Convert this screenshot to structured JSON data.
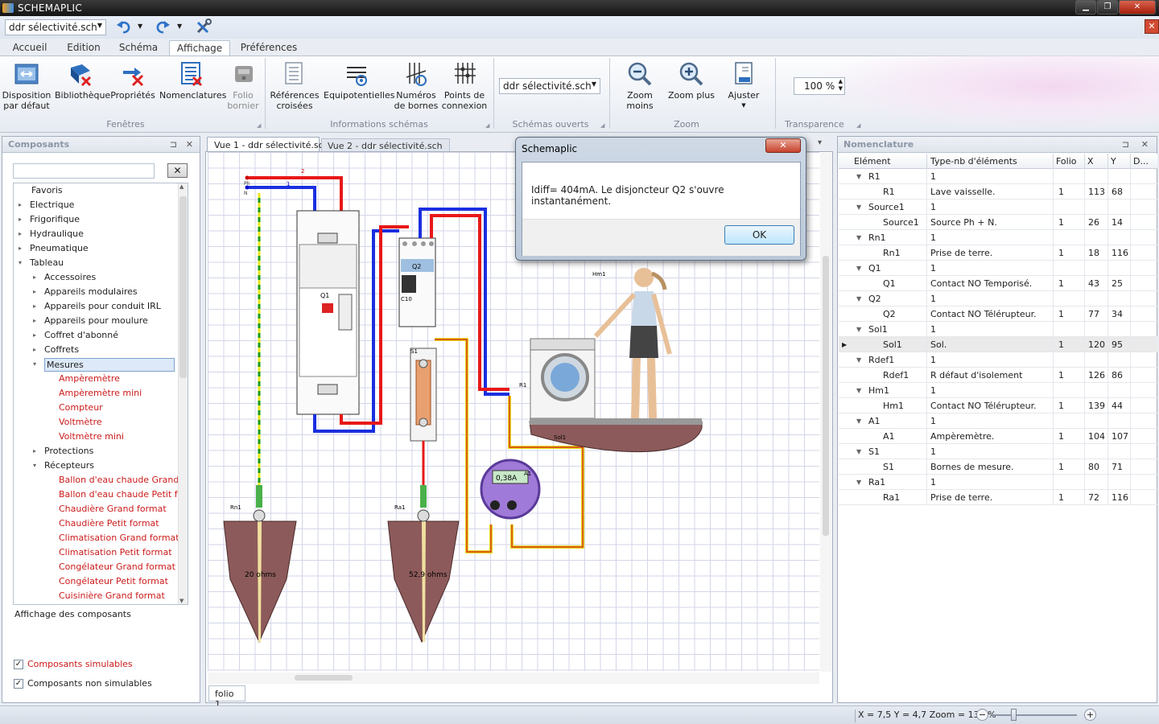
{
  "app": {
    "title": "SCHEMAPLIC",
    "window_min": "▁",
    "window_max": "❐",
    "window_close": "✕"
  },
  "quick_access": {
    "file_combo": "ddr sélectivité.sch",
    "undo_icon": "undo-icon",
    "redo_icon": "redo-icon",
    "tools_icon": "tools-icon",
    "close_doc": "✕"
  },
  "tabs": [
    "Accueil",
    "Edition",
    "Schéma",
    "Affichage",
    "Préférences"
  ],
  "ribbon": {
    "fenetres": {
      "label": "Fenêtres",
      "buttons": [
        {
          "l1": "Disposition",
          "l2": "par défaut"
        },
        {
          "l1": "Bibliothèque",
          "l2": ""
        },
        {
          "l1": "Propriétés",
          "l2": ""
        },
        {
          "l1": "Nomenclatures",
          "l2": ""
        },
        {
          "l1": "Folio",
          "l2": "bornier"
        }
      ]
    },
    "infos": {
      "label": "Informations schémas",
      "buttons": [
        {
          "l1": "Références",
          "l2": "croisées"
        },
        {
          "l1": "Equipotentielles",
          "l2": ""
        },
        {
          "l1": "Numéros",
          "l2": "de bornes"
        },
        {
          "l1": "Points de",
          "l2": "connexion"
        }
      ]
    },
    "schemas": {
      "label": "Schémas ouverts",
      "combo": "ddr sélectivité.sch"
    },
    "zoom": {
      "label": "Zoom",
      "buttons": [
        {
          "l1": "Zoom moins"
        },
        {
          "l1": "Zoom plus"
        },
        {
          "l1": "Ajuster"
        }
      ]
    },
    "transparence": {
      "label": "Transparence",
      "value": "100 %"
    }
  },
  "components": {
    "title": "Composants",
    "pin": "⊐",
    "close": "✕",
    "clear_btn": "✕",
    "tree": [
      {
        "label": "Favoris",
        "level": 0,
        "exp": ""
      },
      {
        "label": "Electrique",
        "level": 0,
        "exp": "▸"
      },
      {
        "label": "Frigorifique",
        "level": 0,
        "exp": "▸"
      },
      {
        "label": "Hydraulique",
        "level": 0,
        "exp": "▸"
      },
      {
        "label": "Pneumatique",
        "level": 0,
        "exp": "▸"
      },
      {
        "label": "Tableau",
        "level": 0,
        "exp": "▾"
      },
      {
        "label": "Accessoires",
        "level": 1,
        "exp": "▸"
      },
      {
        "label": "Appareils modulaires",
        "level": 1,
        "exp": "▸"
      },
      {
        "label": "Appareils pour conduit IRL",
        "level": 1,
        "exp": "▸"
      },
      {
        "label": "Appareils pour moulure",
        "level": 1,
        "exp": "▸"
      },
      {
        "label": "Coffret d'abonné",
        "level": 1,
        "exp": "▸"
      },
      {
        "label": "Coffrets",
        "level": 1,
        "exp": "▸"
      },
      {
        "label": "Mesures",
        "level": 1,
        "exp": "▾",
        "selected": true
      },
      {
        "label": "Ampèremètre",
        "level": 2,
        "red": true
      },
      {
        "label": "Ampèremètre mini",
        "level": 2,
        "red": true
      },
      {
        "label": "Compteur",
        "level": 2,
        "red": true
      },
      {
        "label": "Voltmètre",
        "level": 2,
        "red": true
      },
      {
        "label": "Voltmètre mini",
        "level": 2,
        "red": true
      },
      {
        "label": "Protections",
        "level": 1,
        "exp": "▸"
      },
      {
        "label": "Récepteurs",
        "level": 1,
        "exp": "▾"
      },
      {
        "label": "Ballon d'eau chaude Grand...",
        "level": 2,
        "red": true
      },
      {
        "label": "Ballon d'eau chaude Petit f...",
        "level": 2,
        "red": true
      },
      {
        "label": "Chaudière Grand format",
        "level": 2,
        "red": true
      },
      {
        "label": "Chaudière Petit format",
        "level": 2,
        "red": true
      },
      {
        "label": "Climatisation Grand format",
        "level": 2,
        "red": true
      },
      {
        "label": "Climatisation Petit format",
        "level": 2,
        "red": true
      },
      {
        "label": "Congélateur Grand format",
        "level": 2,
        "red": true
      },
      {
        "label": "Congélateur Petit format",
        "level": 2,
        "red": true
      },
      {
        "label": "Cuisinière Grand format",
        "level": 2,
        "red": true
      }
    ],
    "display_label": "Affichage des composants",
    "check1": "Composants simulables",
    "check2": "Composants non simulables"
  },
  "views": {
    "tab1": "Vue 1 - ddr sélectivité.sch",
    "tab2": "Vue 2 - ddr sélectivité.sch",
    "folio": "folio 1",
    "dropdown": "▾"
  },
  "schematic": {
    "labels": {
      "hm1": "Hm1",
      "r1": "R1",
      "q1": "Q1",
      "q2": "Q2",
      "c10": "C10",
      "s1": "S1",
      "a1": "A1",
      "sol1": "Sol1",
      "rn1": "Rn1",
      "ra1": "Ra1",
      "rn1_val": "20 ohms",
      "ra1_val": "52,9 ohms",
      "meter": "0,38A",
      "w1": "1",
      "w2": "2",
      "ph": "Ph",
      "n": "N"
    }
  },
  "nomenclature": {
    "title": "Nomenclature",
    "pin": "⊐",
    "close": "✕",
    "columns": [
      "Elément",
      "Type-nb d'éléments",
      "Folio",
      "X",
      "Y",
      "D..."
    ],
    "rows": [
      {
        "k": "g",
        "el": "R1",
        "type": "1"
      },
      {
        "k": "c",
        "el": "R1",
        "type": "Lave vaisselle.",
        "folio": "1",
        "x": "113",
        "y": "68"
      },
      {
        "k": "g",
        "el": "Source1",
        "type": "1"
      },
      {
        "k": "c",
        "el": "Source1",
        "type": "Source Ph + N.",
        "folio": "1",
        "x": "26",
        "y": "14"
      },
      {
        "k": "g",
        "el": "Rn1",
        "type": "1"
      },
      {
        "k": "c",
        "el": "Rn1",
        "type": "Prise de terre.",
        "folio": "1",
        "x": "18",
        "y": "116"
      },
      {
        "k": "g",
        "el": "Q1",
        "type": "1"
      },
      {
        "k": "c",
        "el": "Q1",
        "type": "Contact NO Temporisé.",
        "folio": "1",
        "x": "43",
        "y": "25"
      },
      {
        "k": "g",
        "el": "Q2",
        "type": "1"
      },
      {
        "k": "c",
        "el": "Q2",
        "type": "Contact NO Télérupteur.",
        "folio": "1",
        "x": "77",
        "y": "34"
      },
      {
        "k": "g",
        "el": "Sol1",
        "type": "1"
      },
      {
        "k": "c",
        "el": "Sol1",
        "type": "Sol.",
        "folio": "1",
        "x": "120",
        "y": "95",
        "current": true
      },
      {
        "k": "g",
        "el": "Rdef1",
        "type": "1"
      },
      {
        "k": "c",
        "el": "Rdef1",
        "type": "R défaut d'isolement",
        "folio": "1",
        "x": "126",
        "y": "86"
      },
      {
        "k": "g",
        "el": "Hm1",
        "type": "1"
      },
      {
        "k": "c",
        "el": "Hm1",
        "type": "Contact NO Télérupteur.",
        "folio": "1",
        "x": "139",
        "y": "44"
      },
      {
        "k": "g",
        "el": "A1",
        "type": "1"
      },
      {
        "k": "c",
        "el": "A1",
        "type": "Ampèremètre.",
        "folio": "1",
        "x": "104",
        "y": "107"
      },
      {
        "k": "g",
        "el": "S1",
        "type": "1"
      },
      {
        "k": "c",
        "el": "S1",
        "type": "Bornes de mesure.",
        "folio": "1",
        "x": "80",
        "y": "71"
      },
      {
        "k": "g",
        "el": "Ra1",
        "type": "1"
      },
      {
        "k": "c",
        "el": "Ra1",
        "type": "Prise de terre.",
        "folio": "1",
        "x": "72",
        "y": "116"
      }
    ]
  },
  "dialog": {
    "title": "Schemaplic",
    "message": "Idiff= 404mA. Le disjoncteur Q2 s'ouvre instantanément.",
    "ok": "OK",
    "close": "✕"
  },
  "status": {
    "coords": "X = 7,5 Y = 4,7 Zoom = 132 %",
    "zoom_out": "−",
    "zoom_in": "+"
  }
}
